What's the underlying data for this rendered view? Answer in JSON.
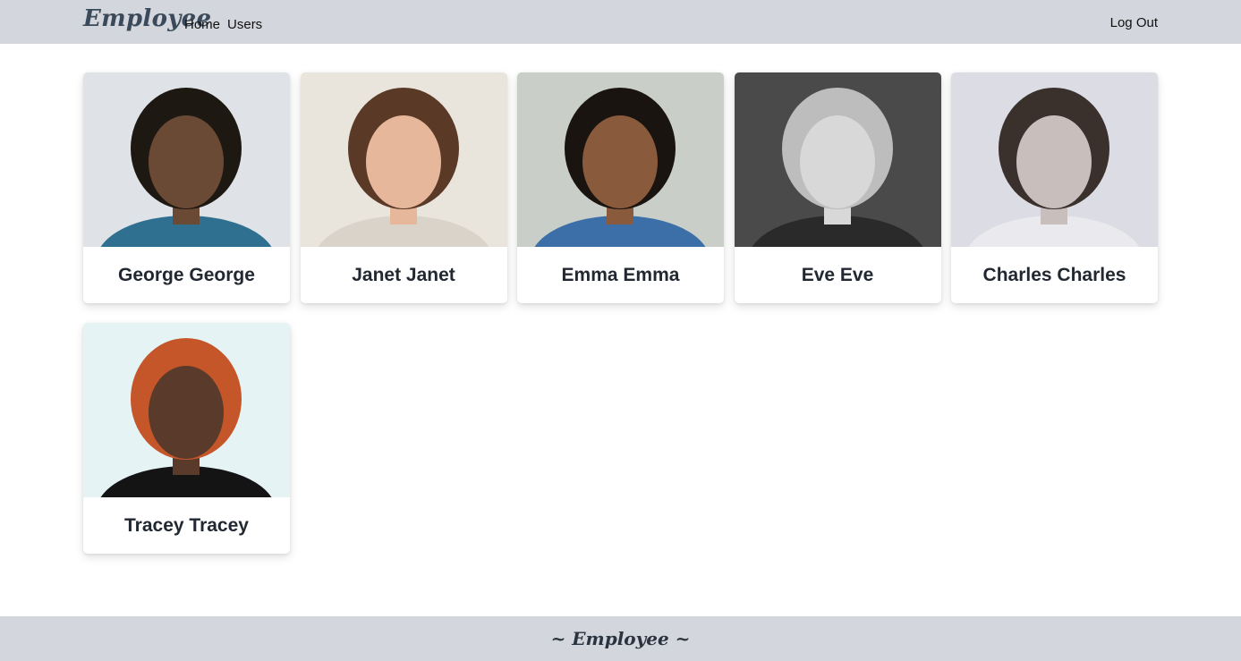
{
  "header": {
    "brand": "Employee",
    "nav": [
      "Home",
      "Users"
    ],
    "logout_label": "Log Out"
  },
  "employees": [
    {
      "name": "George George",
      "bg": "#dfe3e8",
      "skin": "#6b4a35",
      "hair": "#1e1812",
      "shirt": "#2f6f8f"
    },
    {
      "name": "Janet Janet",
      "bg": "#e9e5dd",
      "skin": "#e6b79a",
      "hair": "#5a3a26",
      "shirt": "#d9d3c9"
    },
    {
      "name": "Emma Emma",
      "bg": "#c9cfc8",
      "skin": "#8a5a3c",
      "hair": "#1a1410",
      "shirt": "#3c6fa8"
    },
    {
      "name": "Eve Eve",
      "bg": "#4a4a4a",
      "skin": "#d8d8d8",
      "hair": "#bdbdbd",
      "shirt": "#2a2a2a"
    },
    {
      "name": "Charles Charles",
      "bg": "#dcdde4",
      "skin": "#c8bfbc",
      "hair": "#3a302c",
      "shirt": "#e9e9ee"
    },
    {
      "name": "Tracey Tracey",
      "bg": "#e6f3f5",
      "skin": "#5a3a2a",
      "hair": "#c4562a",
      "shirt": "#141414"
    }
  ],
  "footer": {
    "text": "~ Employee ~"
  }
}
